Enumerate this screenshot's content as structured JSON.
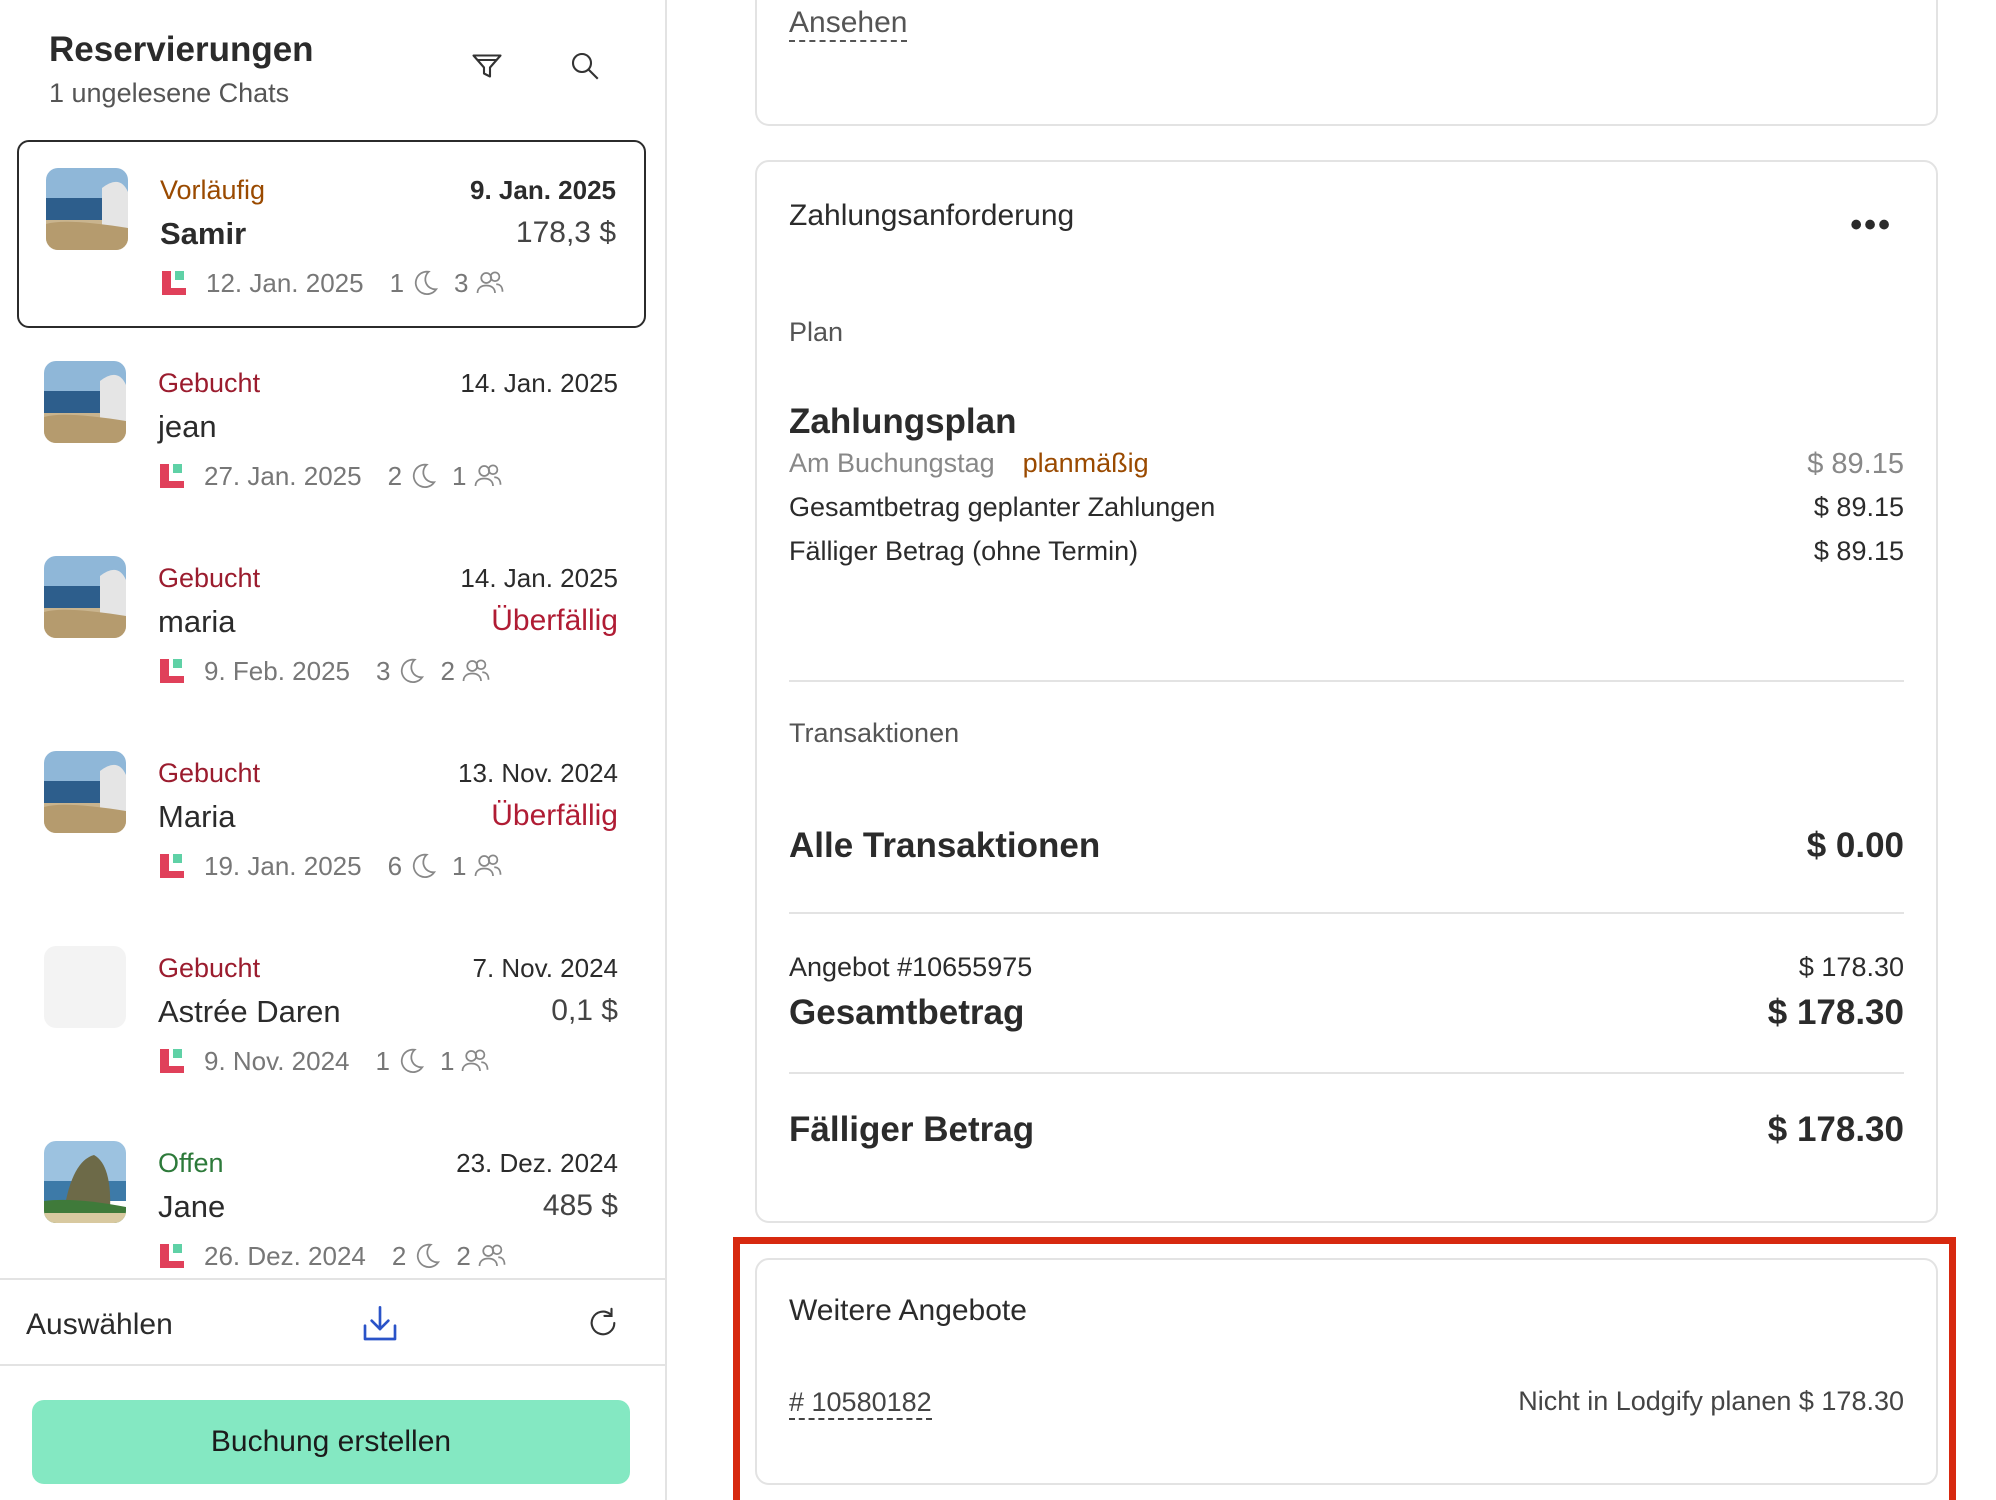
{
  "header": {
    "title": "Reservierungen",
    "subtitle": "1 ungelesene Chats",
    "filter_icon": "filter-icon",
    "search_icon": "search-icon"
  },
  "reservations": [
    {
      "status": "Vorläufig",
      "date": "9. Jan. 2025",
      "name": "Samir",
      "amount": "178,3 $",
      "checkin": "12. Jan. 2025",
      "nights": "1",
      "guests": "3",
      "thumb": "beach"
    },
    {
      "status": "Gebucht",
      "date": "14. Jan. 2025",
      "name": "jean",
      "amount": "",
      "checkin": "27. Jan. 2025",
      "nights": "2",
      "guests": "1",
      "thumb": "beach"
    },
    {
      "status": "Gebucht",
      "date": "14. Jan. 2025",
      "name": "maria",
      "amount": "Überfällig",
      "checkin": "9. Feb. 2025",
      "nights": "3",
      "guests": "2",
      "thumb": "beach"
    },
    {
      "status": "Gebucht",
      "date": "13. Nov. 2024",
      "name": "Maria",
      "amount": "Überfällig",
      "checkin": "19. Jan. 2025",
      "nights": "6",
      "guests": "1",
      "thumb": "beach"
    },
    {
      "status": "Gebucht",
      "date": "7. Nov. 2024",
      "name": "Astrée Daren",
      "amount": "0,1 $",
      "checkin": "9. Nov. 2024",
      "nights": "1",
      "guests": "1",
      "thumb": "none"
    },
    {
      "status": "Offen",
      "date": "23. Dez. 2024",
      "name": "Jane",
      "amount": "485 $",
      "checkin": "26. Dez. 2024",
      "nights": "2",
      "guests": "2",
      "thumb": "cliff"
    }
  ],
  "footer": {
    "select_label": "Auswählen",
    "download_icon": "download-icon",
    "refresh_icon": "refresh-icon",
    "create_button": "Buchung erstellen"
  },
  "top_card": {
    "link": "Ansehen"
  },
  "payment": {
    "title": "Zahlungsanforderung",
    "more_icon": "more-dots-icon",
    "plan_label": "Plan",
    "plan_heading": "Zahlungsplan",
    "booking_day": "Am Buchungstag",
    "scheduled": "planmäßig",
    "booking_day_amount": "$ 89.15",
    "total_scheduled_label": "Gesamtbetrag geplanter Zahlungen",
    "total_scheduled_amount": "$ 89.15",
    "due_unscheduled_label": "Fälliger Betrag (ohne Termin)",
    "due_unscheduled_amount": "$ 89.15",
    "transactions_label": "Transaktionen",
    "all_transactions_label": "Alle Transaktionen",
    "all_transactions_amount": "$ 0.00",
    "offer_label": "Angebot #10655975",
    "offer_amount": "$ 178.30",
    "total_label": "Gesamtbetrag",
    "total_amount": "$ 178.30",
    "due_label": "Fälliger Betrag",
    "due_amount": "$ 178.30"
  },
  "more_offers": {
    "title": "Weitere Angebote",
    "offer_id": "# 10580182",
    "offer_status": "Nicht in Lodgify planen $ 178.30"
  },
  "colors": {
    "tentative": "#9a4a00",
    "booked": "#9b1c2e",
    "open": "#2d7a3a",
    "overdue": "#b01c34",
    "create_button": "#84e8c2",
    "highlight": "#d7290f"
  }
}
